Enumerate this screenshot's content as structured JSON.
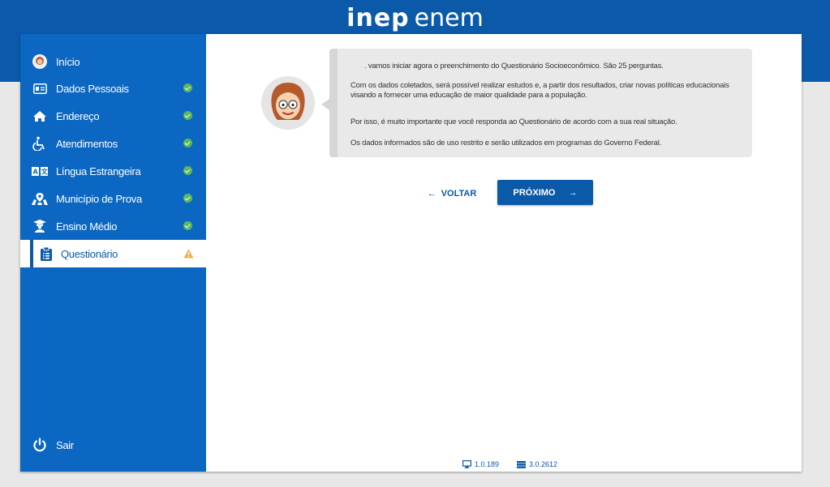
{
  "header": {
    "logo_inep": "inep",
    "logo_enem": "enem"
  },
  "colors": {
    "brand": "#0b5aa9",
    "sidebar": "#0b67c2",
    "success": "#5cb85c",
    "warning": "#f0ad4e"
  },
  "sidebar": {
    "items": [
      {
        "label": "Início",
        "icon": "user-avatar-icon"
      },
      {
        "label": "Dados Pessoais",
        "icon": "id-card-icon",
        "status": "complete"
      },
      {
        "label": "Endereço",
        "icon": "home-icon",
        "status": "complete"
      },
      {
        "label": "Atendimentos",
        "icon": "wheelchair-icon",
        "status": "complete"
      },
      {
        "label": "Língua Estrangeira",
        "icon": "translate-icon",
        "status": "complete"
      },
      {
        "label": "Município de Prova",
        "icon": "map-location-icon",
        "status": "complete"
      },
      {
        "label": "Ensino Médio",
        "icon": "graduation-icon",
        "status": "complete"
      },
      {
        "label": "Questionário",
        "icon": "clipboard-list-icon",
        "status": "warning",
        "active": true
      }
    ],
    "logout_label": "Sair"
  },
  "message": {
    "p1": ". vamos iniciar agora o preenchimento do Questionário Socioeconômico. São 25 perguntas.",
    "p2": "Com os dados coletados, será possível realizar estudos e, a partir dos resultados, criar novas políticas educacionais visando a fornecer uma educação de maior qualidade para a população.",
    "p3": "Por isso, é muito importante que você responda ao Questionário de acordo com a sua real situação.",
    "p4": "Os dados informados são de uso restrito e serão utilizados em programas do Governo Federal."
  },
  "nav": {
    "back_label": "VOLTAR",
    "next_label": "PRÓXIMO"
  },
  "footer": {
    "client_version": "1.0.189",
    "server_version": "3.0.2612"
  }
}
